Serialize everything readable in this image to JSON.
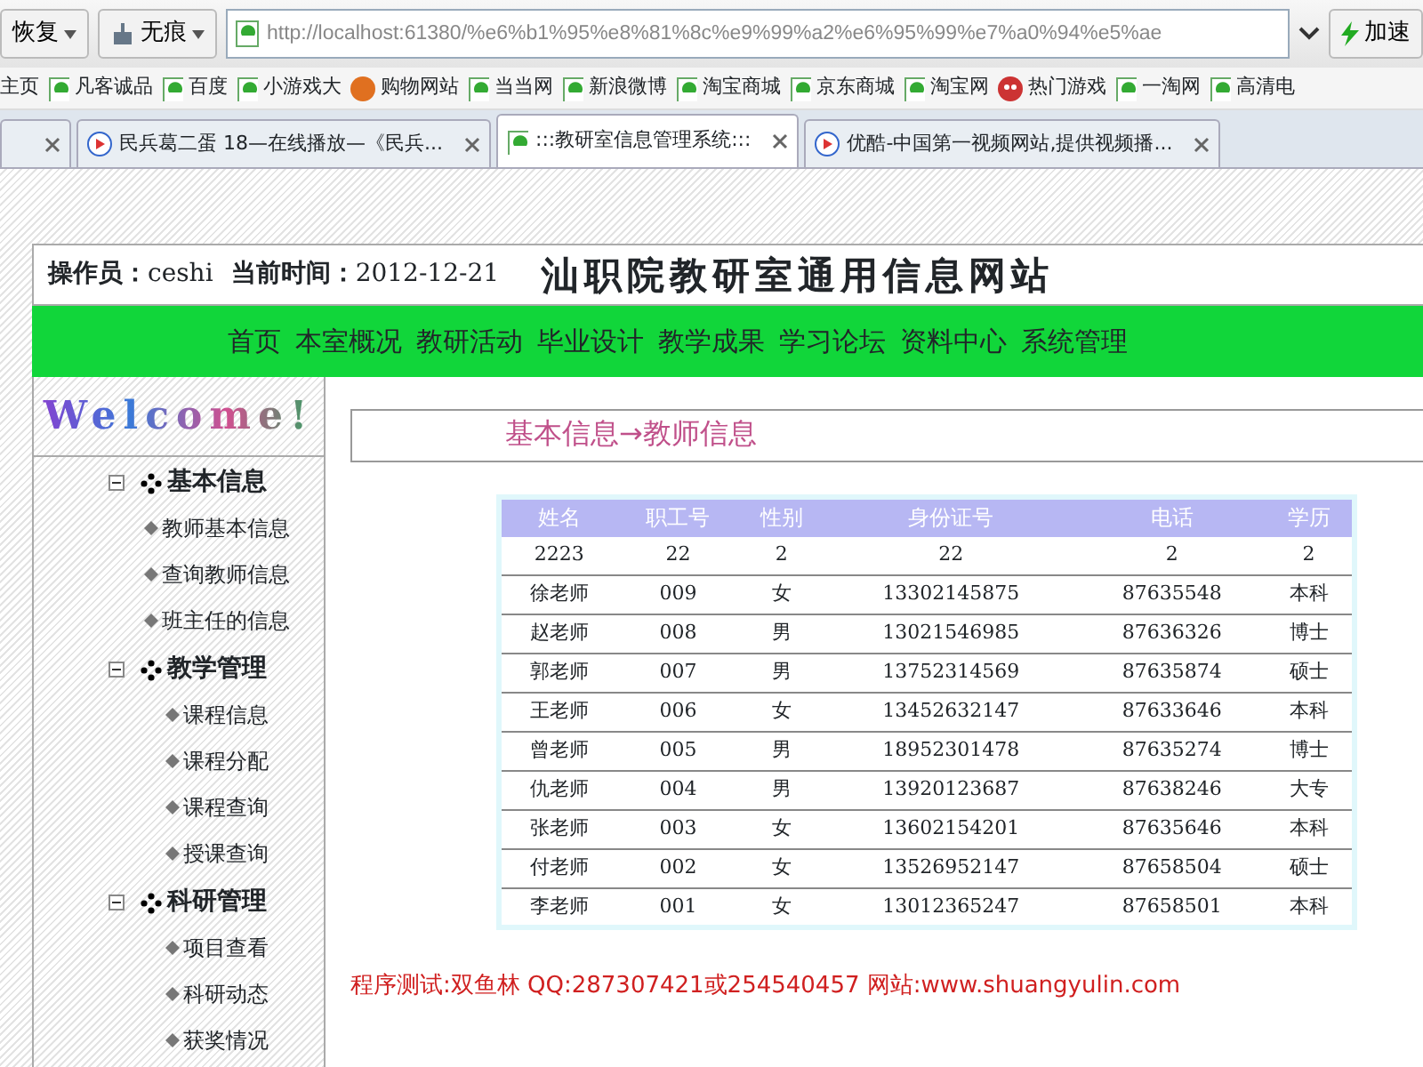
{
  "browser": {
    "restore_button": "恢复",
    "incognito_button": "无痕",
    "address": "http://localhost:61380/%e6%b1%95%e8%81%8c%e9%99%a2%e6%95%99%e7%a0%94%e5%ae",
    "accelerate_button": "加速",
    "bookmarks": [
      {
        "label": "主页",
        "kind": "plain"
      },
      {
        "label": "凡客诚品",
        "kind": "page"
      },
      {
        "label": "百度",
        "kind": "page"
      },
      {
        "label": "小游戏大",
        "kind": "page"
      },
      {
        "label": "购物网站",
        "kind": "shop"
      },
      {
        "label": "当当网",
        "kind": "page"
      },
      {
        "label": "新浪微博",
        "kind": "page"
      },
      {
        "label": "淘宝商城",
        "kind": "page"
      },
      {
        "label": "京东商城",
        "kind": "page"
      },
      {
        "label": "淘宝网",
        "kind": "page"
      },
      {
        "label": "热门游戏",
        "kind": "game"
      },
      {
        "label": "一淘网",
        "kind": "page"
      },
      {
        "label": "高清电",
        "kind": "page"
      }
    ],
    "tabs": [
      {
        "kind": "blank",
        "selected": false
      },
      {
        "label": "民兵葛二蛋 18—在线播放—《民兵...",
        "kind": "video",
        "selected": false
      },
      {
        "label": ":::教研室信息管理系统:::",
        "kind": "page",
        "selected": true
      },
      {
        "label": "优酷-中国第一视频网站,提供视频播...",
        "kind": "video",
        "selected": false
      }
    ]
  },
  "header": {
    "operator_label": "操作员：",
    "operator": "ceshi",
    "time_label": "当前时间：",
    "date": "2012-12-21",
    "site_title": "汕职院教研室通用信息网站"
  },
  "nav": [
    "首页",
    "本室概况",
    "教研活动",
    "毕业设计",
    "教学成果",
    "学习论坛",
    "资料中心",
    "系统管理"
  ],
  "sidebar": {
    "welcome": "Welcome!",
    "groups": [
      {
        "label": "基本信息",
        "expanded": true,
        "children": [
          "教师基本信息",
          "查询教师信息",
          "班主任的信息"
        ]
      },
      {
        "label": "教学管理",
        "expanded": true,
        "children": [
          "课程信息",
          "课程分配",
          "课程查询",
          "授课查询"
        ]
      },
      {
        "label": "科研管理",
        "expanded": true,
        "children": [
          "项目查看",
          "科研动态",
          "获奖情况"
        ]
      }
    ]
  },
  "breadcrumb": "基本信息→教师信息",
  "table": {
    "columns": [
      "姓名",
      "职工号",
      "性别",
      "身份证号",
      "电话",
      "学历"
    ],
    "rows": [
      [
        "2223",
        "22",
        "2",
        "22",
        "2",
        "2"
      ],
      [
        "徐老师",
        "009",
        "女",
        "13302145875",
        "87635548",
        "本科"
      ],
      [
        "赵老师",
        "008",
        "男",
        "13021546985",
        "87636326",
        "博士"
      ],
      [
        "郭老师",
        "007",
        "男",
        "13752314569",
        "87635874",
        "硕士"
      ],
      [
        "王老师",
        "006",
        "女",
        "13452632147",
        "87633646",
        "本科"
      ],
      [
        "曾老师",
        "005",
        "男",
        "18952301478",
        "87635274",
        "博士"
      ],
      [
        "仇老师",
        "004",
        "男",
        "13920123687",
        "87638246",
        "大专"
      ],
      [
        "张老师",
        "003",
        "女",
        "13602154201",
        "87635646",
        "本科"
      ],
      [
        "付老师",
        "002",
        "女",
        "13526952147",
        "87658504",
        "硕士"
      ],
      [
        "李老师",
        "001",
        "女",
        "13012365247",
        "87658501",
        "本科"
      ]
    ]
  },
  "footer": "程序测试:双鱼林 QQ:287307421或254540457 网站:www.shuangyulin.com"
}
